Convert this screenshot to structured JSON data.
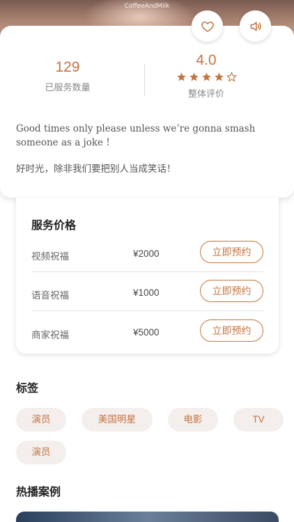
{
  "hero": {
    "watermark": "CoffeeAndMilk"
  },
  "actions": {
    "like_icon": "heart-icon",
    "sound_icon": "speaker-icon"
  },
  "stats": {
    "count_value": "129",
    "count_label": "已服务数量",
    "rating_value": "4.0",
    "rating_label": "整体评价",
    "rating_stars": 4,
    "rating_max": 5
  },
  "description": {
    "english": "Good times only please unless we’re gonna smash someone as a joke !",
    "chinese": "好时光，除非我们要把别人当成笑话！"
  },
  "pricing": {
    "title": "服务价格",
    "rows": [
      {
        "service": "视频祝福",
        "price": "¥2000",
        "button": "立即预约"
      },
      {
        "service": "语音祝福",
        "price": "¥1000",
        "button": "立即预约"
      },
      {
        "service": "商家祝福",
        "price": "¥5000",
        "button": "立即预约"
      }
    ]
  },
  "tags": {
    "title": "标签",
    "items": [
      "演员",
      "美国明星",
      "电影",
      "TV",
      "演员"
    ]
  },
  "cases": {
    "title": "热播案例"
  },
  "colors": {
    "accent": "#c3743f",
    "tag_bg": "#f4eeed"
  }
}
